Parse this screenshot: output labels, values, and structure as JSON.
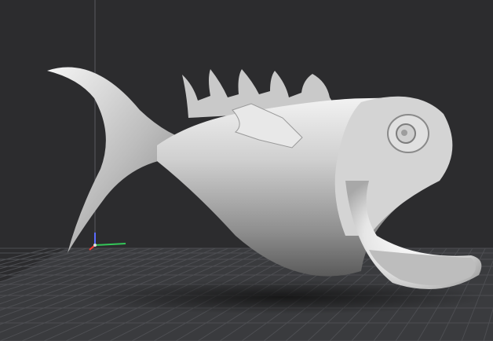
{
  "viewport": {
    "background": "#2c2c2e",
    "build_plate_color": "#3a3b3e",
    "grid_line_color": "#4d4e52",
    "model_color": "#d9d9d9",
    "model_name": "fish-model"
  },
  "axes": {
    "x_color": "#ff3b30",
    "y_color": "#34c759",
    "z_color": "#5b6bff"
  }
}
